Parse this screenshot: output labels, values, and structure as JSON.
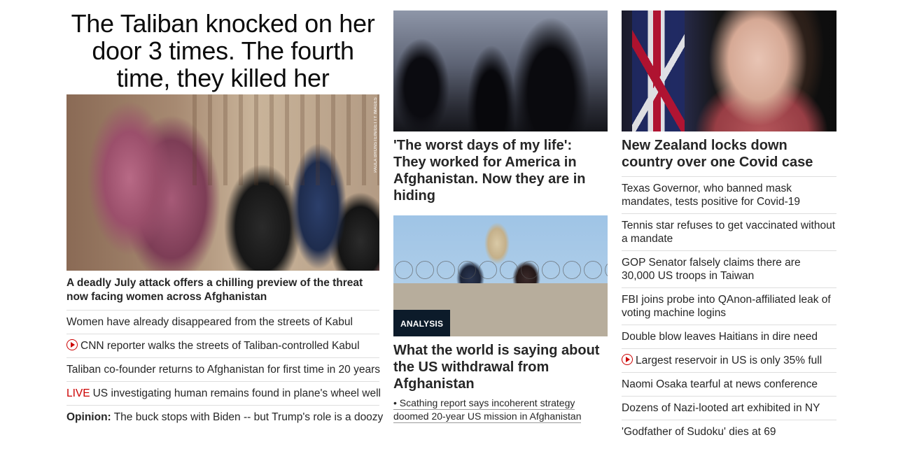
{
  "left": {
    "headline": "The Taliban knocked on her door 3 times. The fourth time, they killed her",
    "image": {
      "credit": "PAULA BRONSTEIN/GETTY IMAGES",
      "alt_icon": "women-in-burqas-photo"
    },
    "subhead": "A deadly July attack offers a chilling preview of the threat now facing women across Afghanistan",
    "links": [
      {
        "text": "Women have already disappeared from the streets of Kabul"
      },
      {
        "prefix_icon": "play-icon",
        "text": "CNN reporter walks the streets of Taliban-controlled Kabul"
      },
      {
        "text": "Taliban co-founder returns to Afghanistan for first time in 20 years"
      },
      {
        "tag": "LIVE",
        "text": "US investigating human remains found in plane's wheel well"
      },
      {
        "tag": "Opinion:",
        "text": "The buck stops with Biden -- but Trump's role is a doozy"
      }
    ]
  },
  "middle": {
    "story1": {
      "headline": "'The worst days of my life': They worked for America in Afghanistan. Now they are in hiding"
    },
    "story2": {
      "badge": "ANALYSIS",
      "headline": "What the world is saying about the US withdrawal from Afghanistan",
      "bullet": "• Scathing report says incoherent strategy doomed 20-year US mission in Afghanistan"
    }
  },
  "right": {
    "headline": "New Zealand locks down country over one Covid case",
    "links": [
      {
        "text": "Texas Governor, who banned mask mandates, tests positive for Covid-19"
      },
      {
        "text": "Tennis star refuses to get vaccinated without a mandate"
      },
      {
        "text": "GOP Senator falsely claims there are 30,000 US troops in Taiwan"
      },
      {
        "text": "FBI joins probe into QAnon-affiliated leak of voting machine logins"
      },
      {
        "text": "Double blow leaves Haitians in dire need"
      },
      {
        "prefix_icon": "play-icon",
        "text": "Largest reservoir in US is only 35% full"
      },
      {
        "text": "Naomi Osaka tearful at news conference"
      },
      {
        "text": "Dozens of Nazi-looted art exhibited in NY"
      },
      {
        "text": "'Godfather of Sudoku' dies at 69"
      }
    ]
  },
  "colors": {
    "live": "#cc0000",
    "play_icon": "#cc0000",
    "badge_bg": "#0c1b2a",
    "divider": "#dedede",
    "text": "#262626"
  }
}
